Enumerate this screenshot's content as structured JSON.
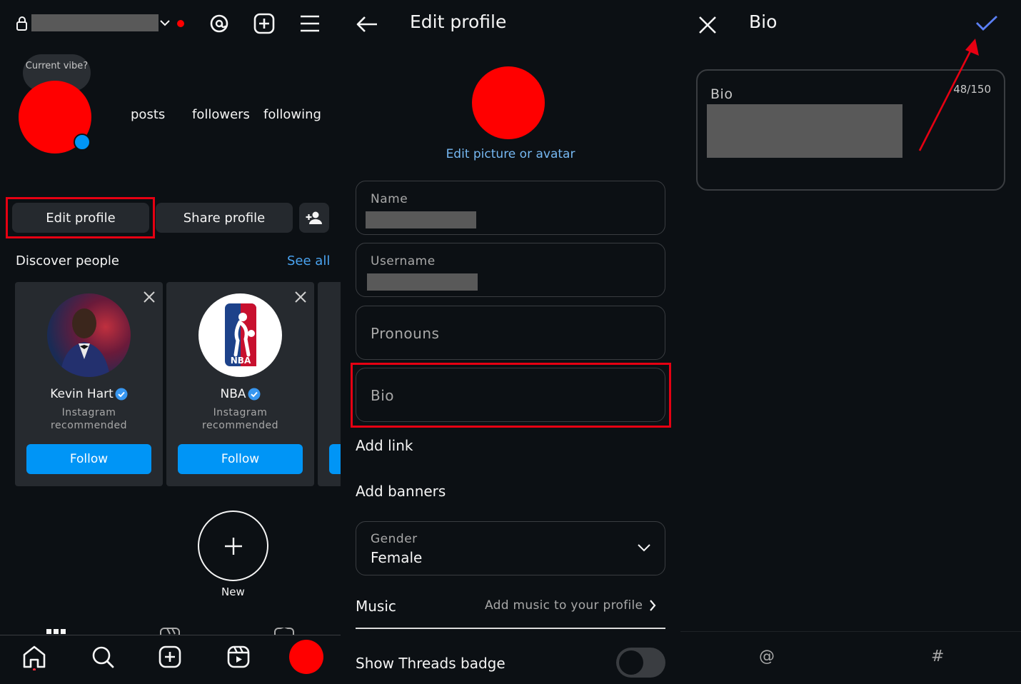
{
  "profile": {
    "vibe_bubble": "Current vibe?",
    "stats": {
      "posts": "posts",
      "followers": "followers",
      "following": "following"
    },
    "edit_profile": "Edit profile",
    "share_profile": "Share profile",
    "discover_title": "Discover people",
    "see_all": "See all",
    "cards": [
      {
        "name": "Kevin Hart",
        "sub1": "Instagram",
        "sub2": "recommended",
        "follow": "Follow"
      },
      {
        "name": "NBA",
        "sub1": "Instagram",
        "sub2": "recommended",
        "follow": "Follow"
      }
    ],
    "new_highlight": "New"
  },
  "edit": {
    "title": "Edit profile",
    "edit_picture": "Edit picture or avatar",
    "name_label": "Name",
    "username_label": "Username",
    "pronouns_label": "Pronouns",
    "bio_label": "Bio",
    "add_link": "Add link",
    "add_banners": "Add banners",
    "gender_label": "Gender",
    "gender_value": "Female",
    "music_label": "Music",
    "music_hint": "Add music to your profile",
    "threads_badge": "Show Threads badge"
  },
  "bio": {
    "title": "Bio",
    "label": "Bio",
    "counter": "48/150",
    "at_key": "@",
    "hash_key": "#"
  },
  "colors": {
    "background": "#0c1014",
    "accent_blue": "#0095f6",
    "highlight_red": "#e60012",
    "check_blue": "#5b7ff5"
  }
}
